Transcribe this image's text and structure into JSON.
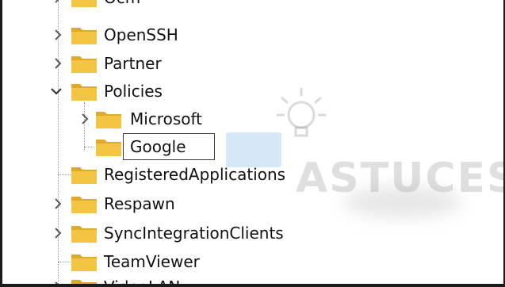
{
  "tree": {
    "items": [
      {
        "label": "Ocm",
        "state": "collapsed"
      },
      {
        "label": "OpenSSH",
        "state": "collapsed"
      },
      {
        "label": "Partner",
        "state": "collapsed"
      },
      {
        "label": "Policies",
        "state": "expanded"
      },
      {
        "label": "Microsoft",
        "state": "collapsed"
      },
      {
        "label": "Google",
        "state": "renaming"
      },
      {
        "label": "RegisteredApplications",
        "state": "leaf"
      },
      {
        "label": "Respawn",
        "state": "collapsed"
      },
      {
        "label": "SyncIntegrationClients",
        "state": "collapsed"
      },
      {
        "label": "TeamViewer",
        "state": "leaf"
      },
      {
        "label": "VideoLAN",
        "state": "collapsed"
      }
    ]
  },
  "watermark": {
    "text": "ASTUCES"
  },
  "colors": {
    "folder": "#f4c542",
    "folder_shade": "#e0a82e",
    "chevron": "#5a5a5a",
    "border": "#1c1c1c"
  }
}
